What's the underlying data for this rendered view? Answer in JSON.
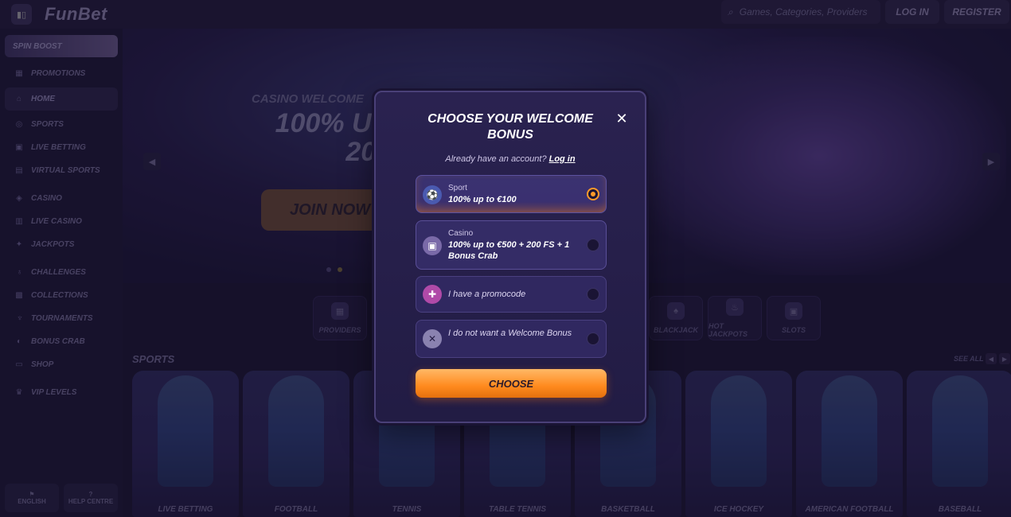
{
  "topbar": {
    "logo": "FunBet",
    "search_placeholder": "Games, Categories, Providers",
    "login": "LOG IN",
    "register": "REGISTER"
  },
  "sidebar": {
    "spin_boost": "SPIN BOOST",
    "items": [
      {
        "label": "PROMOTIONS",
        "icon": "gift-icon"
      },
      {
        "label": "HOME",
        "icon": "home-icon"
      },
      {
        "label": "SPORTS",
        "icon": "ball-icon"
      },
      {
        "label": "LIVE BETTING",
        "icon": "live-icon"
      },
      {
        "label": "VIRTUAL SPORTS",
        "icon": "vr-icon"
      },
      {
        "label": "CASINO",
        "icon": "casino-icon"
      },
      {
        "label": "LIVE CASINO",
        "icon": "cards-icon"
      },
      {
        "label": "JACKPOTS",
        "icon": "jackpot-icon"
      },
      {
        "label": "CHALLENGES",
        "icon": "medal-icon"
      },
      {
        "label": "COLLECTIONS",
        "icon": "collection-icon"
      },
      {
        "label": "TOURNAMENTS",
        "icon": "trophy-icon"
      },
      {
        "label": "BONUS CRAB",
        "icon": "crab-icon"
      },
      {
        "label": "SHOP",
        "icon": "shop-icon"
      },
      {
        "label": "VIP LEVELS",
        "icon": "crown-icon"
      }
    ],
    "bottom": {
      "language": "ENGLISH",
      "help": "HELP CENTRE"
    }
  },
  "hero": {
    "eyebrow": "CASINO WELCOME",
    "title_line1": "100% UP TO",
    "title_line2": "200 FS",
    "cta": "JOIN NOW"
  },
  "categories": [
    "PROVIDERS",
    "BLACKJACK",
    "HOT JACKPOTS",
    "SLOTS"
  ],
  "sports": {
    "title": "SPORTS",
    "see_all": "SEE ALL",
    "cards": [
      "LIVE BETTING",
      "FOOTBALL",
      "TENNIS",
      "TABLE TENNIS",
      "BASKETBALL",
      "ICE HOCKEY",
      "AMERICAN FOOTBALL",
      "BASEBALL"
    ]
  },
  "modal": {
    "title": "CHOOSE YOUR WELCOME BONUS",
    "account_text": "Already have an account?",
    "login_link": "Log in",
    "options": [
      {
        "category": "Sport",
        "text": "100% up to €100",
        "selected": true
      },
      {
        "category": "Casino",
        "text": "100% up to €500 + 200 FS + 1 Bonus Crab",
        "selected": false
      },
      {
        "category": "",
        "text": "I have a promocode",
        "selected": false
      },
      {
        "category": "",
        "text": "I do not want a Welcome Bonus",
        "selected": false
      }
    ],
    "choose": "CHOOSE"
  },
  "colors": {
    "accent": "#ff9a2a",
    "background": "#1a1430",
    "modal": "#2a2250"
  }
}
